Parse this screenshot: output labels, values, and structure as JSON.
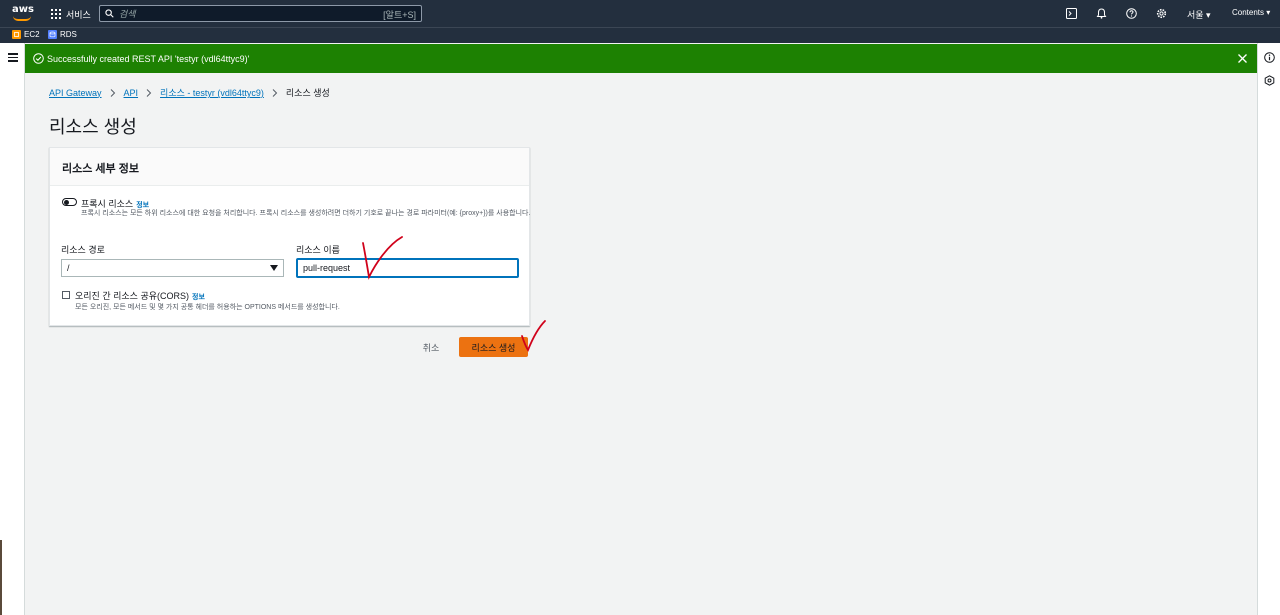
{
  "topnav": {
    "logo_text": "aws",
    "services_label": "서비스",
    "search_placeholder": "검색",
    "search_shortcut": "[알트+S]",
    "region": "서울 ▾",
    "account": "Contents ▾"
  },
  "favorites": [
    {
      "label": "EC2",
      "color": "#ff9900"
    },
    {
      "label": "RDS",
      "color": "#527fff"
    }
  ],
  "flash": {
    "message": "Successfully created REST API 'testyr (vdl64ttyc9)'",
    "color": "#1d8102"
  },
  "breadcrumb": {
    "items": [
      "API Gateway",
      "API",
      "리소스 - testyr (vdl64ttyc9)"
    ],
    "current": "리소스 생성"
  },
  "page": {
    "title": "리소스 생성"
  },
  "panel": {
    "title": "리소스 세부 정보",
    "proxy": {
      "label": "프록시 리소스",
      "info": "정보",
      "description": "프록시 리소스는 모든 하위 리소스에 대한 요청을 처리합니다. 프록시 리소스를 생성하려면 더하기 기호로 끝나는 경로 파라미터(예: {proxy+})를 사용합니다.",
      "enabled": false
    },
    "path": {
      "label": "리소스 경로",
      "value": "/"
    },
    "name": {
      "label": "리소스 이름",
      "value": "pull-request"
    },
    "cors": {
      "label": "오리진 간 리소스 공유(CORS)",
      "info": "정보",
      "description": "모든 오리진, 모든 메서드 및 몇 가지 공통 헤더를 허용하는 OPTIONS 메서드를 생성합니다.",
      "checked": false
    }
  },
  "actions": {
    "cancel_label": "취소",
    "create_label": "리소스 생성",
    "primary_color": "#ec7211"
  },
  "annotation_color": "#d0021b"
}
